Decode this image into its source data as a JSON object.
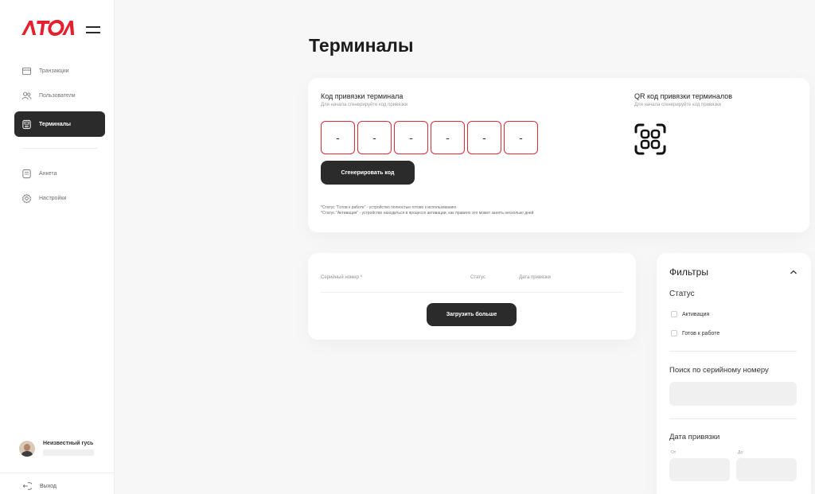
{
  "brand": {
    "logo_text": "ATOL",
    "accent_color": "#e4202e"
  },
  "sidebar": {
    "items": [
      {
        "label": "Транзакции",
        "icon": "wallet-icon"
      },
      {
        "label": "Пользователи",
        "icon": "users-icon"
      },
      {
        "label": "Терминалы",
        "icon": "terminal-icon",
        "active": true
      },
      {
        "label": "Анкета",
        "icon": "form-icon"
      },
      {
        "label": "Настройки",
        "icon": "gear-icon"
      }
    ],
    "user_name": "Неизвестный гусь",
    "logout_label": "Выход"
  },
  "page": {
    "title": "Терминалы"
  },
  "bind_card": {
    "title": "Код привязки терминала",
    "subtitle": "Для начала сгенерируйте код привязки",
    "code": [
      "-",
      "-",
      "-",
      "-",
      "-",
      "-"
    ],
    "generate_label": "Сгенерировать код",
    "note_1": "*Статус \"Готов к работе\" - устройство полностью готово к использованию",
    "note_2": "*Статус \"Активация\" - устройство находиться в процессе активации, как правило это может занять несколько дней",
    "qr_title": "QR код привязки терминалов",
    "qr_subtitle": "Для начала сгенерируйте код привязки"
  },
  "table": {
    "col_serial": "Серийный номер ^",
    "col_status": "Статус",
    "col_date": "Дата привязки",
    "load_more_label": "Загрузить больше"
  },
  "filters": {
    "title": "Фильтры",
    "status_label": "Статус",
    "options": [
      "Активация",
      "Готов к работе"
    ],
    "serial_search_label": "Поиск по серийному номеру",
    "serial_search_value": "",
    "date_label": "Дата привязки",
    "from_label": "От",
    "to_label": "До",
    "from_value": "",
    "to_value": ""
  }
}
